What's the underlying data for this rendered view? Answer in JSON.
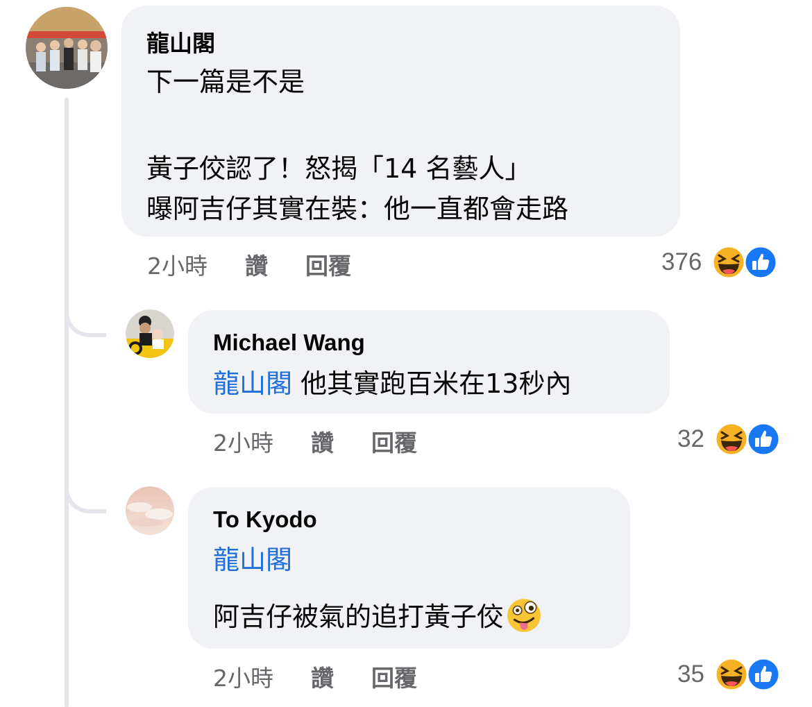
{
  "comments": [
    {
      "author": "龍山閣",
      "body_lines": [
        "下一篇是不是",
        "",
        "黃子佼認了！怒揭「14 名藝人」",
        "曝阿吉仔其實在裝：他一直都會走路"
      ],
      "time": "2小時",
      "like_label": "讚",
      "reply_label": "回覆",
      "reaction_count": "376",
      "reaction_icons": [
        "haha-icon",
        "like-icon"
      ]
    }
  ],
  "replies": [
    {
      "author": "Michael Wang",
      "mention": "龍山閣",
      "body": "他其實跑百米在13秒內",
      "time": "2小時",
      "like_label": "讚",
      "reply_label": "回覆",
      "reaction_count": "32",
      "reaction_icons": [
        "haha-icon",
        "like-icon"
      ]
    },
    {
      "author": "To Kyodo",
      "mention": "龍山閣",
      "body": "阿吉仔被氣的追打黃子佼",
      "body_emoji": "zany-face-icon",
      "time": "2小時",
      "like_label": "讚",
      "reply_label": "回覆",
      "reaction_count": "35",
      "reaction_icons": [
        "haha-icon",
        "like-icon"
      ]
    }
  ],
  "colors": {
    "bubble": "#f0f2f5",
    "mention": "#216fdb",
    "meta": "#65676b",
    "like_blue": "#1877f2",
    "haha_yellow": "#f7b125"
  }
}
